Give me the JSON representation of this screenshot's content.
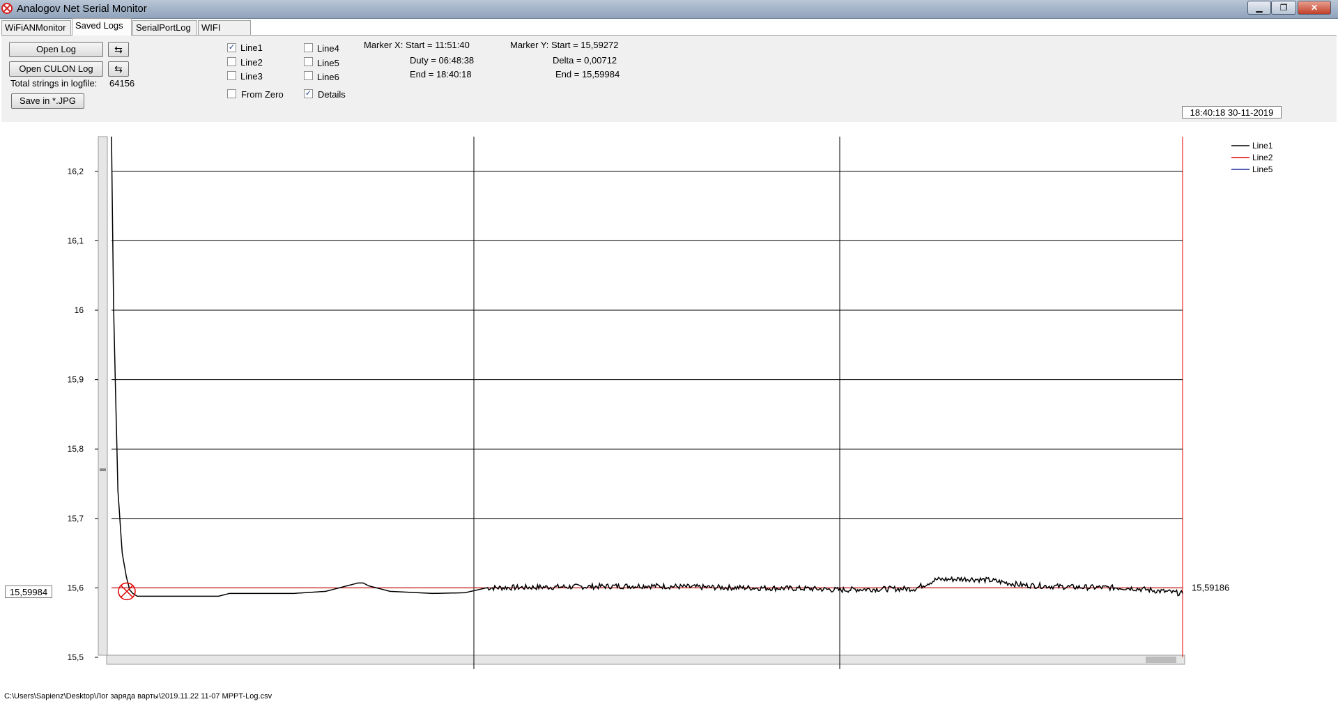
{
  "window": {
    "title": "Analogov Net Serial Monitor"
  },
  "tabs": [
    {
      "label": "WiFiANMonitor"
    },
    {
      "label": "Saved Logs"
    },
    {
      "label": "SerialPortLog"
    },
    {
      "label": "WIFI logers"
    }
  ],
  "toolbar": {
    "open_log_label": "Open Log",
    "open_culon_log_label": "Open CULON Log",
    "total_strings_label": "Total strings in logfile:",
    "total_strings_value": "64156",
    "save_jpg_label": "Save in *.JPG"
  },
  "checkboxes": {
    "line1": {
      "label": "Line1",
      "checked": true
    },
    "line2": {
      "label": "Line2",
      "checked": false
    },
    "line3": {
      "label": "Line3",
      "checked": false
    },
    "line4": {
      "label": "Line4",
      "checked": false
    },
    "line5": {
      "label": "Line5",
      "checked": false
    },
    "line6": {
      "label": "Line6",
      "checked": false
    },
    "from_zero": {
      "label": "From Zero",
      "checked": false
    },
    "details": {
      "label": "Details",
      "checked": true
    }
  },
  "marker_x": {
    "start": "Marker X: Start = 11:51:40",
    "duty": "Duty = 06:48:38",
    "end": "End  = 18:40:18"
  },
  "marker_y": {
    "start": "Marker Y: Start = 15,59272",
    "delta": "Delta = 0,00712",
    "end": "End  = 15,59984"
  },
  "datetime": "18:40:18 30-11-2019",
  "cursor_value_left": "15,59984",
  "cursor_value_right": "15,59186",
  "status_path": "C:\\Users\\Sapienz\\Desktop\\Лог заряда варты\\2019.11.22 11-07 MPPT-Log.csv",
  "chart_data": {
    "type": "line",
    "y_ticks": [
      "16,2",
      "16,1",
      "16",
      "15,9",
      "15,8",
      "15,7",
      "15,6",
      "15,5"
    ],
    "ylim": [
      15.5,
      16.25
    ],
    "legend": [
      "Line1",
      "Line2",
      "Line5"
    ],
    "legend_position": "top-right",
    "grid": true,
    "colors": {
      "Line1": "#000000",
      "Line2": "#e00000",
      "Line5": "#1a2a9a"
    },
    "series": [
      {
        "name": "Line1",
        "x": [
          0.0,
          0.002,
          0.006,
          0.01,
          0.014,
          0.017,
          0.02,
          0.024,
          0.05,
          0.1,
          0.11,
          0.14,
          0.17,
          0.2,
          0.23,
          0.235,
          0.24,
          0.26,
          0.3,
          0.33,
          0.35,
          0.4,
          0.45,
          0.5,
          0.55,
          0.6,
          0.65,
          0.68,
          0.7,
          0.75,
          0.77,
          0.8,
          0.82,
          0.85,
          0.9,
          0.95,
          1.0
        ],
        "values": [
          16.25,
          16.0,
          15.74,
          15.65,
          15.615,
          15.597,
          15.592,
          15.588,
          15.588,
          15.588,
          15.592,
          15.592,
          15.592,
          15.595,
          15.607,
          15.607,
          15.603,
          15.595,
          15.592,
          15.593,
          15.6,
          15.601,
          15.602,
          15.603,
          15.601,
          15.6,
          15.599,
          15.597,
          15.598,
          15.599,
          15.612,
          15.613,
          15.611,
          15.604,
          15.601,
          15.6,
          15.592
        ]
      },
      {
        "name": "Line2",
        "x": [
          0.0,
          1.0
        ],
        "values": [
          15.6,
          15.6
        ]
      }
    ]
  }
}
